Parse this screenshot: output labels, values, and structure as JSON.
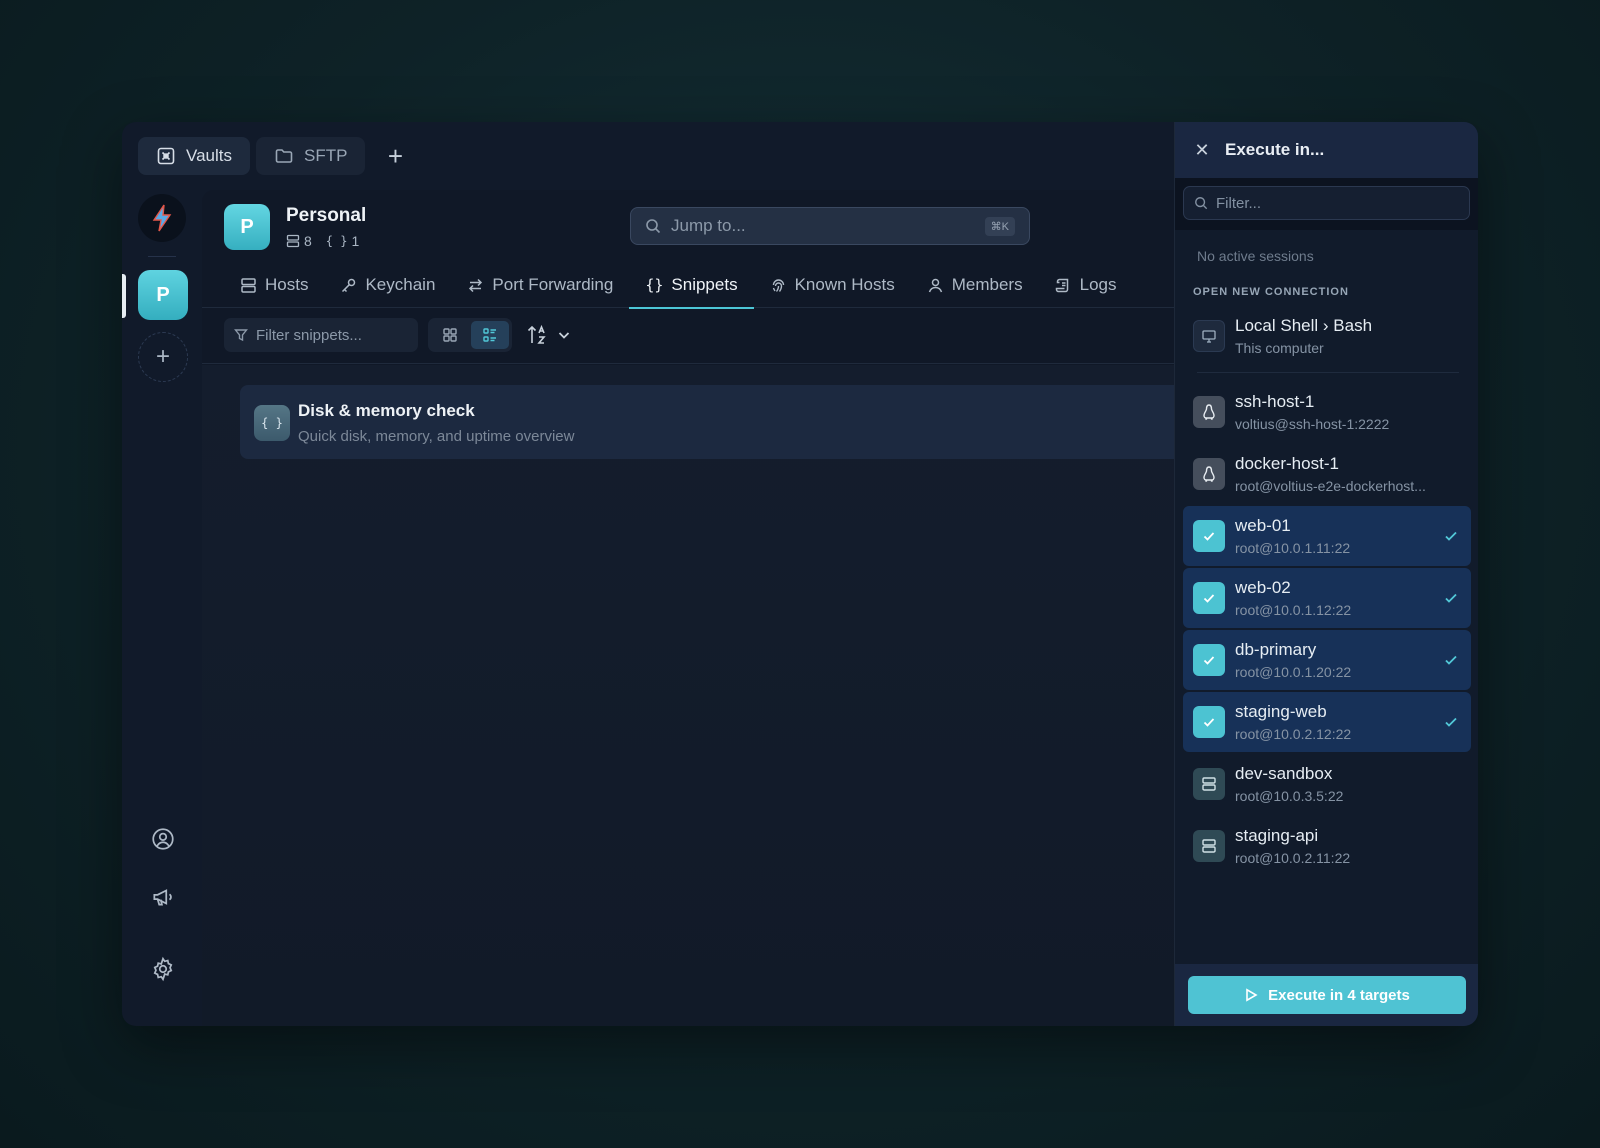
{
  "tabs": [
    {
      "label": "Vaults",
      "icon": "vault-icon",
      "active": true
    },
    {
      "label": "SFTP",
      "icon": "folder-icon",
      "active": false
    }
  ],
  "tab_add_label": "+",
  "vault": {
    "avatar_letter": "P",
    "name": "Personal",
    "hosts_count": "8",
    "snippets_count": "1"
  },
  "rail": {
    "vault_letter": "P",
    "add_label": "+"
  },
  "jump": {
    "placeholder": "Jump to...",
    "shortcut": "⌘K"
  },
  "nav": [
    {
      "label": "Hosts",
      "icon": "server-icon"
    },
    {
      "label": "Keychain",
      "icon": "key-icon"
    },
    {
      "label": "Port Forwarding",
      "icon": "arrows-icon"
    },
    {
      "label": "Snippets",
      "icon": "braces-icon",
      "active": true
    },
    {
      "label": "Known Hosts",
      "icon": "fingerprint-icon"
    },
    {
      "label": "Members",
      "icon": "user-icon"
    },
    {
      "label": "Logs",
      "icon": "scroll-icon"
    }
  ],
  "toolbar": {
    "filter_placeholder": "Filter snippets..."
  },
  "snippets": [
    {
      "title": "Disk & memory check",
      "description": "Quick disk, memory, and uptime overview",
      "icon_text": "{ }"
    }
  ],
  "panel": {
    "title": "Execute in...",
    "filter_placeholder": "Filter...",
    "no_sessions": "No active sessions",
    "section_label": "OPEN NEW CONNECTION",
    "local": {
      "name": "Local Shell › Bash",
      "sub": "This computer"
    },
    "hosts": [
      {
        "name": "ssh-host-1",
        "sub": "voltius@ssh-host-1:2222",
        "kind": "linux",
        "selected": false
      },
      {
        "name": "docker-host-1",
        "sub": "root@voltius-e2e-dockerhost...",
        "kind": "linux",
        "selected": false
      },
      {
        "name": "web-01",
        "sub": "root@10.0.1.11:22",
        "kind": "check",
        "selected": true
      },
      {
        "name": "web-02",
        "sub": "root@10.0.1.12:22",
        "kind": "check",
        "selected": true
      },
      {
        "name": "db-primary",
        "sub": "root@10.0.1.20:22",
        "kind": "check",
        "selected": true
      },
      {
        "name": "staging-web",
        "sub": "root@10.0.2.12:22",
        "kind": "check",
        "selected": true
      },
      {
        "name": "dev-sandbox",
        "sub": "root@10.0.3.5:22",
        "kind": "server",
        "selected": false
      },
      {
        "name": "staging-api",
        "sub": "root@10.0.2.11:22",
        "kind": "server",
        "selected": false
      }
    ],
    "execute_label": "Execute in 4 targets"
  },
  "colors": {
    "accent": "#4fc3d3",
    "selected_row": "#173158",
    "window_bg": "#111a2a"
  }
}
